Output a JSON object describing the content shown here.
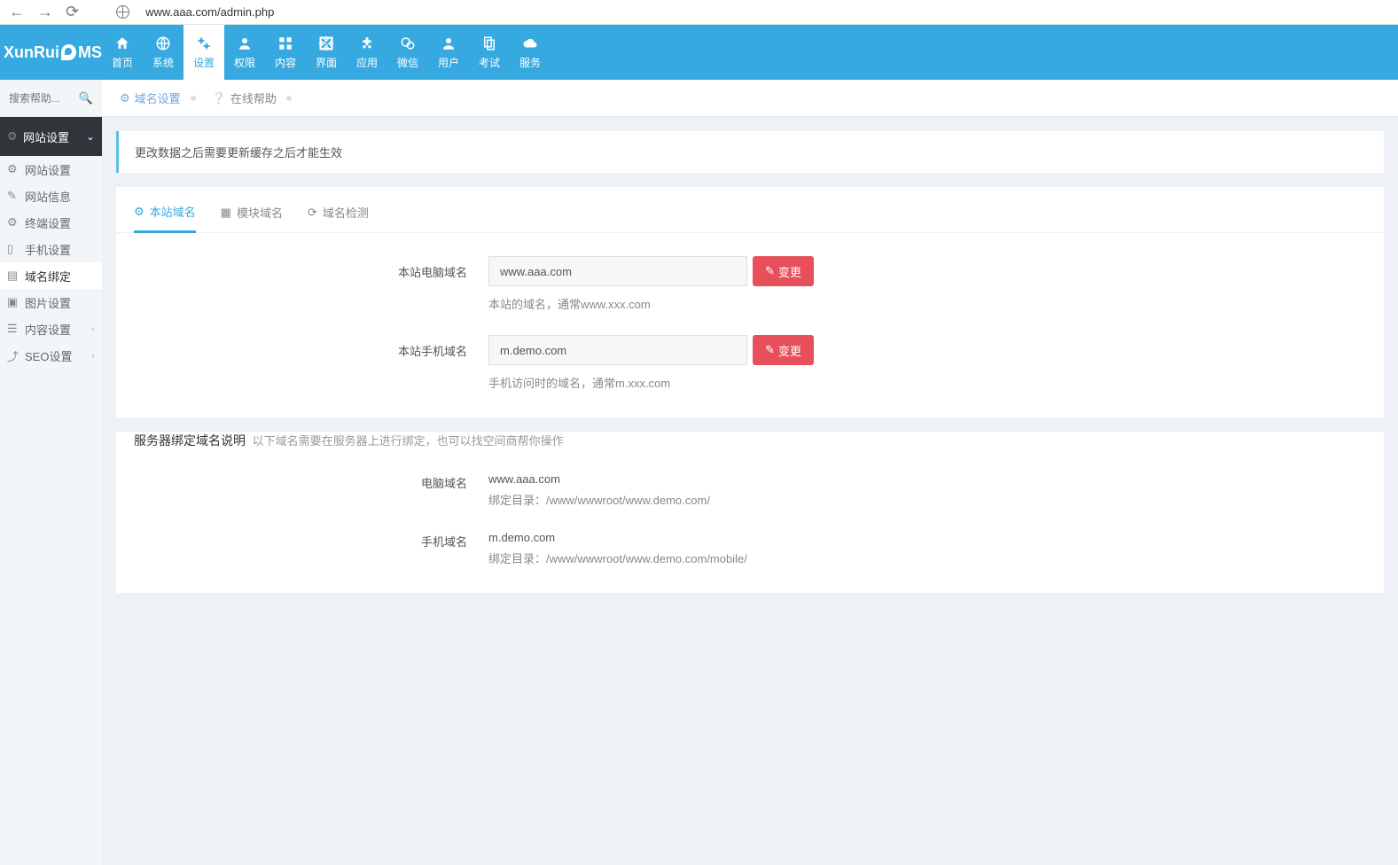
{
  "browser": {
    "url": "www.aaa.com/admin.php"
  },
  "logo": {
    "pre": "XunRui",
    "post": "MS"
  },
  "topnav": [
    {
      "label": "首页"
    },
    {
      "label": "系统"
    },
    {
      "label": "设置"
    },
    {
      "label": "权限"
    },
    {
      "label": "内容"
    },
    {
      "label": "界面"
    },
    {
      "label": "应用"
    },
    {
      "label": "微信"
    },
    {
      "label": "用户"
    },
    {
      "label": "考试"
    },
    {
      "label": "服务"
    }
  ],
  "sidebar": {
    "search_placeholder": "搜索帮助...",
    "group": "网站设置",
    "items": [
      {
        "label": "网站设置"
      },
      {
        "label": "网站信息"
      },
      {
        "label": "终端设置"
      },
      {
        "label": "手机设置"
      },
      {
        "label": "域名绑定"
      },
      {
        "label": "图片设置"
      },
      {
        "label": "内容设置",
        "sub": true
      },
      {
        "label": "SEO设置",
        "sub": true
      }
    ]
  },
  "page_tabs": {
    "one": "域名设置",
    "two": "在线帮助"
  },
  "alert": "更改数据之后需要更新缓存之后才能生效",
  "inner_tabs": {
    "a": "本站域名",
    "b": "模块域名",
    "c": "域名检测"
  },
  "form": {
    "pc": {
      "label": "本站电脑域名",
      "value": "www.aaa.com",
      "btn": "变更",
      "hint": "本站的域名，通常www.xxx.com"
    },
    "m": {
      "label": "本站手机域名",
      "value": "m.demo.com",
      "btn": "变更",
      "hint": "手机访问时的域名，通常m.xxx.com"
    }
  },
  "server": {
    "title": "服务器绑定域名说明",
    "sub": "以下域名需要在服务器上进行绑定，也可以找空间商帮你操作",
    "pc": {
      "label": "电脑域名",
      "v": "www.aaa.com",
      "path": "绑定目录：/www/wwwroot/www.demo.com/"
    },
    "m": {
      "label": "手机域名",
      "v": "m.demo.com",
      "path": "绑定目录：/www/wwwroot/www.demo.com/mobile/"
    }
  }
}
